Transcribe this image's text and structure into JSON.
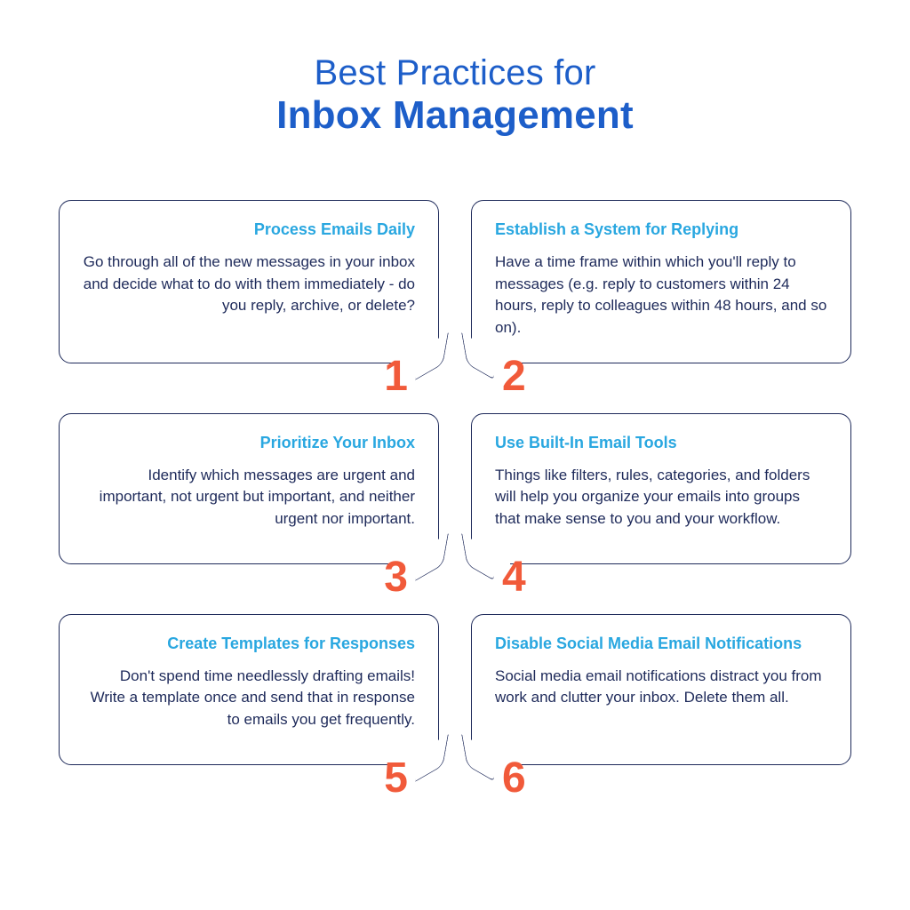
{
  "title": {
    "line1": "Best Practices for",
    "line2": "Inbox Management"
  },
  "colors": {
    "heading": "#1d5ec9",
    "card_title": "#29a7e0",
    "body_text": "#1e2a5a",
    "number": "#f15a3a",
    "border": "#1e2a5a"
  },
  "cards": [
    {
      "n": "1",
      "title": "Process Emails Daily",
      "body": "Go through all of the new messages in your inbox and decide what to do with them immediately - do you reply, archive, or delete?"
    },
    {
      "n": "2",
      "title": "Establish a System for Replying",
      "body": "Have a time frame within which you'll reply to messages (e.g. reply to customers within 24 hours, reply to colleagues within 48 hours, and so on)."
    },
    {
      "n": "3",
      "title": "Prioritize Your Inbox",
      "body": "Identify which messages are urgent and important, not urgent but important, and neither urgent nor important."
    },
    {
      "n": "4",
      "title": "Use Built-In Email Tools",
      "body": "Things like filters, rules, categories, and folders will help you organize your emails into groups that make sense to you and your workflow."
    },
    {
      "n": "5",
      "title": "Create Templates for Responses",
      "body": "Don't spend time needlessly drafting emails! Write a template once and send that in response to emails you get frequently."
    },
    {
      "n": "6",
      "title": "Disable Social Media Email Notifications",
      "body": "Social media email notifications distract you from work and clutter your inbox. Delete them all."
    }
  ]
}
